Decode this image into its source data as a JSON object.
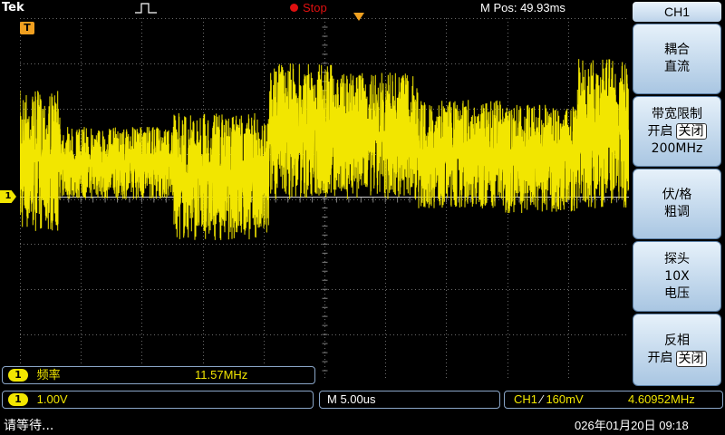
{
  "header": {
    "brand": "Tek",
    "run_state": "Stop",
    "m_pos": "M Pos: 49.93ms"
  },
  "indicators": {
    "trigger_marker": "T",
    "ch1_marker": "1"
  },
  "side_menu": {
    "title": "CH1",
    "coupling_label": "耦合",
    "coupling_value": "直流",
    "bw_limit_label": "带宽限制",
    "bw_on": "开启",
    "bw_off": "关闭",
    "bw_value": "200MHz",
    "volts_div_label": "伏/格",
    "volts_div_value": "粗调",
    "probe_label": "探头",
    "probe_value": "10X",
    "probe_type": "电压",
    "invert_label": "反相",
    "invert_on": "开启",
    "invert_off": "关闭"
  },
  "measurement": {
    "channel": "1",
    "label": "频率",
    "value": "11.57MHz"
  },
  "readouts": {
    "channel": "1",
    "volts_per_div": "1.00V",
    "timebase": "M 5.00us",
    "trigger_source": "CH1",
    "trigger_slope": "⁄",
    "trigger_level": "160mV",
    "trigger_freq": "4.60952MHz"
  },
  "status": {
    "message": "请等待...",
    "datetime": "026年01月20日 09:18"
  },
  "colors": {
    "trace": "#f2e600",
    "stop": "#e01010",
    "trigger": "#f0a020",
    "menu_bg": "#bcd3ea"
  }
}
